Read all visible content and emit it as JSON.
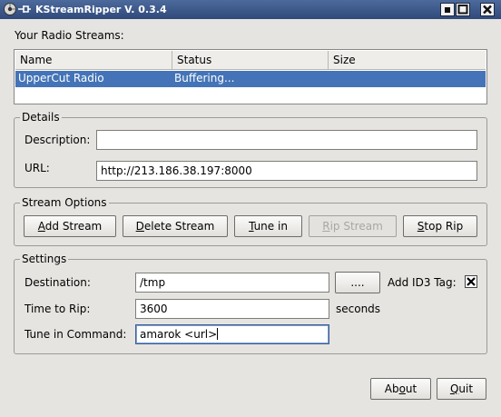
{
  "window": {
    "title": "KStreamRipper V. 0.3.4",
    "app_icon": "kstreamripper-icon",
    "buttons": [
      "minimize-icon",
      "maximize-icon",
      "close-icon"
    ]
  },
  "streams": {
    "heading": "Your Radio Streams:",
    "columns": [
      "Name",
      "Status",
      "Size"
    ],
    "rows": [
      {
        "name": "UpperCut Radio",
        "status": "Buffering...",
        "size": ""
      }
    ],
    "selected_color": "#4474b7"
  },
  "details": {
    "title": "Details",
    "description_label": "Description:",
    "description_value": "",
    "url_label": "URL:",
    "url_value": "http://213.186.38.197:8000"
  },
  "stream_options": {
    "title": "Stream Options",
    "add_stream": {
      "mnemonic": "A",
      "rest": "dd Stream"
    },
    "delete_stream": {
      "mnemonic": "D",
      "rest": "elete Stream"
    },
    "tune_in": {
      "mnemonic": "T",
      "rest": "une in"
    },
    "rip_stream": {
      "mnemonic": "R",
      "rest": "ip Stream"
    },
    "stop_rip": {
      "mnemonic": "S",
      "rest": "top Rip"
    }
  },
  "settings": {
    "title": "Settings",
    "destination_label": "Destination:",
    "destination_value": "/tmp",
    "browse_label": "....",
    "id3_label": "Add ID3 Tag:",
    "id3_checked": true,
    "time_label": "Time to Rip:",
    "time_value": "3600",
    "time_unit": "seconds",
    "tune_cmd_label": "Tune in Command:",
    "tune_cmd_value": "amarok <url>"
  },
  "footer": {
    "about": {
      "before": "Ab",
      "mnemonic": "o",
      "after": "ut"
    },
    "quit": {
      "mnemonic": "Q",
      "rest": "uit"
    }
  }
}
